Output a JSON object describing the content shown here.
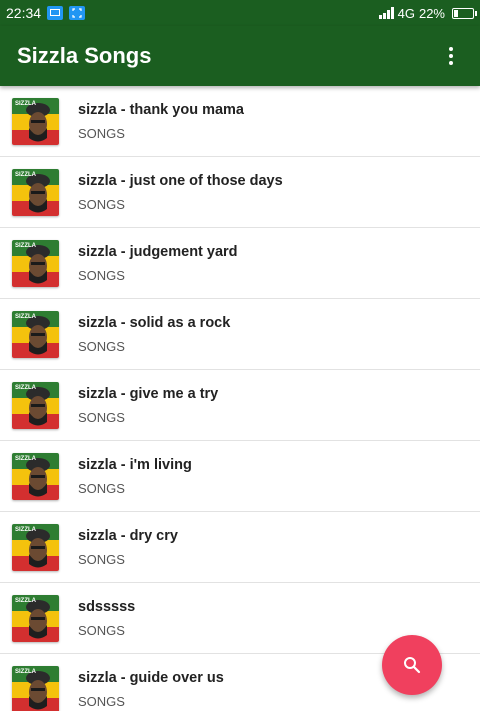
{
  "status_bar": {
    "time": "22:34",
    "network": "4G",
    "battery": "22%",
    "battery_level": 0.22
  },
  "app_bar": {
    "title": "Sizzla Songs",
    "menu_icon": "more-vert-icon"
  },
  "thumbnail": {
    "label": "SIZZLA",
    "colors": [
      "#2e7d32",
      "#f4c20d",
      "#d32f2f"
    ]
  },
  "songs": [
    {
      "title": "sizzla - thank you mama",
      "subtitle": "SONGS"
    },
    {
      "title": "sizzla - just one of those days",
      "subtitle": "SONGS"
    },
    {
      "title": "sizzla - judgement yard",
      "subtitle": "SONGS"
    },
    {
      "title": "sizzla - solid as a rock",
      "subtitle": "SONGS"
    },
    {
      "title": "sizzla - give me a try",
      "subtitle": "SONGS"
    },
    {
      "title": "sizzla - i'm living",
      "subtitle": "SONGS"
    },
    {
      "title": "sizzla - dry cry",
      "subtitle": "SONGS"
    },
    {
      "title": "sdsssss",
      "subtitle": "SONGS"
    },
    {
      "title": "sizzla - guide over us",
      "subtitle": "SONGS"
    }
  ],
  "fab": {
    "icon": "search-icon",
    "color": "#f0405e"
  }
}
